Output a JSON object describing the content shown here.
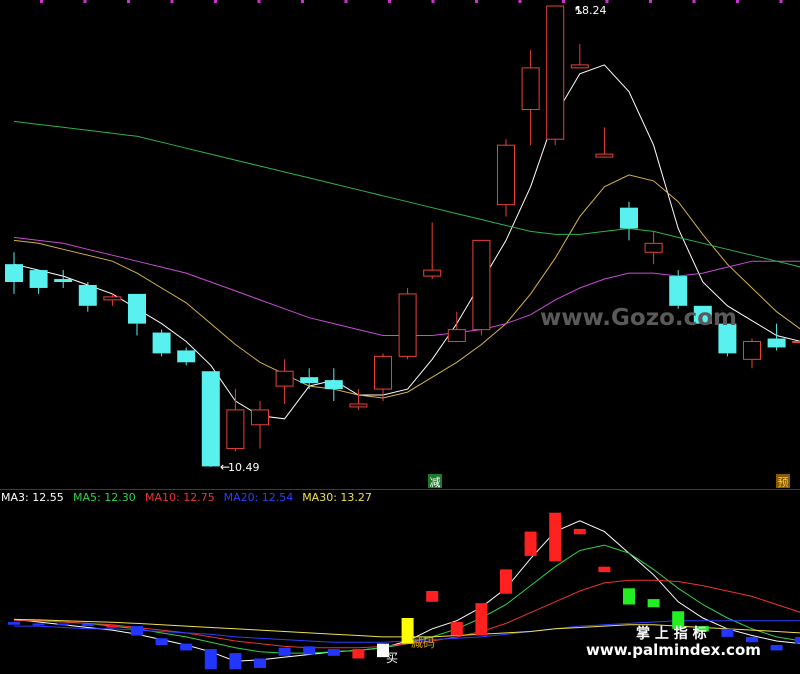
{
  "colors": {
    "bg": "#000000",
    "up": "#e8413a",
    "down": "#59f0f0",
    "ma_white": "#ffffff",
    "ma_green": "#2fb34a",
    "ma_magenta": "#c84bd6",
    "ma_yellow": "#d6b24a",
    "dots": "#cc33cc",
    "divider": "#8b1a1a"
  },
  "labels": {
    "high": "18.24",
    "low": "10.49",
    "sig_jian": "减",
    "sig_yu": "预",
    "bottom_jian": "减码",
    "bottom_mai": "买",
    "watermark1": "www.Gozo.com",
    "watermark2_title": "掌 上 指 标",
    "watermark2_url": "www.palmindex.com"
  },
  "legend": [
    {
      "label": "MA3:",
      "value": "12.55",
      "color": "#ffffff"
    },
    {
      "label": "MA5:",
      "value": "12.30",
      "color": "#2fd14a"
    },
    {
      "label": "MA10:",
      "value": "12.75",
      "color": "#e83434"
    },
    {
      "label": "MA20:",
      "value": "12.54",
      "color": "#2d3dff"
    },
    {
      "label": "MA30:",
      "value": "13.27",
      "color": "#f0e050"
    }
  ],
  "chart_data": {
    "type": "candlestick",
    "upper_candles": [
      {
        "open": 13.6,
        "close": 13.9,
        "high": 14.1,
        "low": 13.4,
        "dir": "down"
      },
      {
        "open": 13.5,
        "close": 13.8,
        "high": 13.8,
        "low": 13.4,
        "dir": "down"
      },
      {
        "open": 13.6,
        "close": 13.65,
        "high": 13.8,
        "low": 13.5,
        "dir": "down"
      },
      {
        "open": 13.2,
        "close": 13.55,
        "high": 13.6,
        "low": 13.1,
        "dir": "down"
      },
      {
        "open": 13.3,
        "close": 13.35,
        "high": 13.4,
        "low": 13.2,
        "dir": "up"
      },
      {
        "open": 12.9,
        "close": 13.4,
        "high": 13.4,
        "low": 12.7,
        "dir": "down"
      },
      {
        "open": 12.4,
        "close": 12.75,
        "high": 12.8,
        "low": 12.35,
        "dir": "down"
      },
      {
        "open": 12.25,
        "close": 12.45,
        "high": 12.5,
        "low": 12.2,
        "dir": "down"
      },
      {
        "open": 10.5,
        "close": 12.1,
        "high": 12.1,
        "low": 10.49,
        "dir": "down"
      },
      {
        "open": 10.8,
        "close": 11.45,
        "high": 11.8,
        "low": 10.75,
        "dir": "up"
      },
      {
        "open": 11.2,
        "close": 11.45,
        "high": 11.6,
        "low": 10.8,
        "dir": "up"
      },
      {
        "open": 11.85,
        "close": 12.1,
        "high": 12.3,
        "low": 11.55,
        "dir": "up"
      },
      {
        "open": 11.9,
        "close": 12.0,
        "high": 12.15,
        "low": 11.8,
        "dir": "down"
      },
      {
        "open": 11.8,
        "close": 11.95,
        "high": 12.15,
        "low": 11.6,
        "dir": "down"
      },
      {
        "open": 11.5,
        "close": 11.55,
        "high": 11.8,
        "low": 11.45,
        "dir": "up"
      },
      {
        "open": 11.8,
        "close": 12.35,
        "high": 12.4,
        "low": 11.6,
        "dir": "up"
      },
      {
        "open": 12.35,
        "close": 13.4,
        "high": 13.5,
        "low": 12.3,
        "dir": "up"
      },
      {
        "open": 13.7,
        "close": 13.8,
        "high": 14.6,
        "low": 13.65,
        "dir": "up"
      },
      {
        "open": 12.6,
        "close": 12.8,
        "high": 13.1,
        "low": 12.6,
        "dir": "up"
      },
      {
        "open": 12.8,
        "close": 14.3,
        "high": 14.3,
        "low": 12.7,
        "dir": "up"
      },
      {
        "open": 14.9,
        "close": 15.9,
        "high": 16.0,
        "low": 14.7,
        "dir": "up"
      },
      {
        "open": 16.5,
        "close": 17.2,
        "high": 17.5,
        "low": 15.9,
        "dir": "up"
      },
      {
        "open": 16.0,
        "close": 18.24,
        "high": 18.24,
        "low": 15.9,
        "dir": "up"
      },
      {
        "open": 17.2,
        "close": 17.25,
        "high": 17.6,
        "low": 17.2,
        "dir": "up"
      },
      {
        "open": 15.7,
        "close": 15.75,
        "high": 16.2,
        "low": 15.7,
        "dir": "up"
      },
      {
        "open": 14.5,
        "close": 14.85,
        "high": 14.95,
        "low": 14.3,
        "dir": "down"
      },
      {
        "open": 14.1,
        "close": 14.25,
        "high": 14.45,
        "low": 13.9,
        "dir": "up"
      },
      {
        "open": 13.2,
        "close": 13.7,
        "high": 13.8,
        "low": 13.15,
        "dir": "down"
      },
      {
        "open": 12.9,
        "close": 13.2,
        "high": 13.2,
        "low": 12.9,
        "dir": "down"
      },
      {
        "open": 12.4,
        "close": 12.9,
        "high": 12.9,
        "low": 12.35,
        "dir": "down"
      },
      {
        "open": 12.3,
        "close": 12.6,
        "high": 12.65,
        "low": 12.15,
        "dir": "up"
      },
      {
        "open": 12.5,
        "close": 12.65,
        "high": 12.9,
        "low": 12.45,
        "dir": "down"
      },
      {
        "open": 12.6,
        "close": 12.6,
        "high": 12.9,
        "low": 12.55,
        "dir": "up"
      }
    ],
    "ma_upper": {
      "white": [
        13.9,
        13.8,
        13.7,
        13.55,
        13.4,
        13.15,
        12.9,
        12.6,
        12.2,
        11.6,
        11.35,
        11.3,
        11.85,
        11.95,
        11.7,
        11.7,
        11.8,
        12.3,
        12.9,
        13.6,
        14.3,
        15.2,
        16.4,
        17.1,
        17.25,
        16.8,
        15.9,
        14.5,
        13.6,
        13.2,
        12.95,
        12.7,
        12.6
      ],
      "yellow": [
        14.3,
        14.25,
        14.15,
        14.05,
        13.95,
        13.75,
        13.5,
        13.25,
        12.9,
        12.55,
        12.25,
        12.05,
        11.85,
        11.8,
        11.7,
        11.65,
        11.75,
        12.0,
        12.25,
        12.55,
        12.9,
        13.4,
        14.0,
        14.7,
        15.2,
        15.4,
        15.3,
        14.95,
        14.4,
        13.9,
        13.5,
        13.1,
        12.8
      ],
      "magenta": [
        14.35,
        14.3,
        14.25,
        14.15,
        14.05,
        13.95,
        13.85,
        13.75,
        13.6,
        13.45,
        13.3,
        13.15,
        13.0,
        12.9,
        12.8,
        12.7,
        12.7,
        12.7,
        12.75,
        12.8,
        12.9,
        13.05,
        13.3,
        13.5,
        13.65,
        13.75,
        13.75,
        13.7,
        13.75,
        13.85,
        13.95,
        13.95,
        13.95
      ],
      "green": [
        16.3,
        16.25,
        16.2,
        16.15,
        16.1,
        16.05,
        15.95,
        15.85,
        15.75,
        15.65,
        15.55,
        15.45,
        15.35,
        15.25,
        15.15,
        15.05,
        14.95,
        14.85,
        14.75,
        14.65,
        14.55,
        14.45,
        14.4,
        14.4,
        14.45,
        14.5,
        14.45,
        14.35,
        14.25,
        14.15,
        14.05,
        13.95,
        13.85
      ]
    },
    "lower_indicator": {
      "blocks": [
        {
          "top": 0.25,
          "bottom": 0.15,
          "color": "#2236ff"
        },
        {
          "top": 0.2,
          "bottom": 0.13,
          "color": "#2236ff"
        },
        {
          "top": 0.2,
          "bottom": 0.13,
          "color": "#2236ff"
        },
        {
          "top": 0.18,
          "bottom": 0.1,
          "color": "#2236ff"
        },
        {
          "top": 0.12,
          "bottom": 0.07,
          "color": "#ff2020"
        },
        {
          "top": 0.1,
          "bottom": -0.25,
          "color": "#2236ff"
        },
        {
          "top": -0.35,
          "bottom": -0.6,
          "color": "#2236ff"
        },
        {
          "top": -0.55,
          "bottom": -0.8,
          "color": "#2236ff"
        },
        {
          "top": -0.75,
          "bottom": -1.5,
          "color": "#2236ff"
        },
        {
          "top": -0.9,
          "bottom": -1.5,
          "color": "#2236ff"
        },
        {
          "top": -1.1,
          "bottom": -1.45,
          "color": "#2236ff"
        },
        {
          "top": -0.7,
          "bottom": -1.0,
          "color": "#2236ff"
        },
        {
          "top": -0.65,
          "bottom": -0.95,
          "color": "#2236ff"
        },
        {
          "top": -0.75,
          "bottom": -1.0,
          "color": "#2236ff"
        },
        {
          "top": -0.75,
          "bottom": -1.1,
          "color": "#ff2020"
        },
        {
          "top": -0.55,
          "bottom": -1.05,
          "color": "#ffffff"
        },
        {
          "top": 0.4,
          "bottom": -0.55,
          "color": "#ffff00"
        },
        {
          "top": 1.4,
          "bottom": 1.0,
          "color": "#ff2020"
        },
        {
          "top": 0.25,
          "bottom": -0.25,
          "color": "#ff2020"
        },
        {
          "top": 0.95,
          "bottom": -0.25,
          "color": "#ff2020"
        },
        {
          "top": 2.2,
          "bottom": 1.3,
          "color": "#ff2020"
        },
        {
          "top": 3.6,
          "bottom": 2.7,
          "color": "#ff2020"
        },
        {
          "top": 4.3,
          "bottom": 2.5,
          "color": "#ff2020"
        },
        {
          "top": 3.7,
          "bottom": 3.5,
          "color": "#ff2020"
        },
        {
          "top": 2.3,
          "bottom": 2.1,
          "color": "#ff2020"
        },
        {
          "top": 1.5,
          "bottom": 0.9,
          "color": "#22ee22"
        },
        {
          "top": 1.1,
          "bottom": 0.8,
          "color": "#22ee22"
        },
        {
          "top": 0.65,
          "bottom": 0.0,
          "color": "#22ee22"
        },
        {
          "top": 0.1,
          "bottom": -0.1,
          "color": "#22ee22"
        },
        {
          "top": 0.0,
          "bottom": -0.3,
          "color": "#2236ff"
        },
        {
          "top": -0.3,
          "bottom": -0.5,
          "color": "#2236ff"
        },
        {
          "top": -0.6,
          "bottom": -0.8,
          "color": "#2236ff"
        },
        {
          "top": -0.3,
          "bottom": -0.55,
          "color": "#2236ff"
        }
      ],
      "lines": {
        "white": [
          0.35,
          0.25,
          0.15,
          0.05,
          -0.05,
          -0.2,
          -0.4,
          -0.6,
          -0.85,
          -1.2,
          -1.15,
          -1.05,
          -0.95,
          -0.85,
          -0.8,
          -0.7,
          -0.45,
          0.0,
          0.3,
          0.8,
          1.5,
          2.6,
          3.6,
          4.0,
          3.6,
          2.8,
          2.0,
          1.0,
          0.4,
          0.0,
          -0.25,
          -0.45,
          -0.55
        ],
        "green": [
          0.35,
          0.3,
          0.25,
          0.2,
          0.1,
          0.0,
          -0.15,
          -0.3,
          -0.5,
          -0.7,
          -0.85,
          -0.9,
          -0.9,
          -0.85,
          -0.8,
          -0.7,
          -0.55,
          -0.3,
          0.0,
          0.4,
          0.9,
          1.6,
          2.3,
          2.9,
          3.1,
          2.8,
          2.2,
          1.5,
          0.9,
          0.4,
          0.0,
          -0.3,
          -0.45
        ],
        "red": [
          0.3,
          0.3,
          0.25,
          0.2,
          0.15,
          0.05,
          -0.05,
          -0.15,
          -0.3,
          -0.45,
          -0.55,
          -0.65,
          -0.7,
          -0.7,
          -0.7,
          -0.65,
          -0.55,
          -0.45,
          -0.3,
          -0.1,
          0.2,
          0.6,
          1.0,
          1.4,
          1.7,
          1.8,
          1.8,
          1.75,
          1.6,
          1.4,
          1.2,
          0.9,
          0.6
        ],
        "blue": [
          0.1,
          0.1,
          0.05,
          0.0,
          0.0,
          -0.05,
          -0.1,
          -0.15,
          -0.2,
          -0.3,
          -0.35,
          -0.4,
          -0.45,
          -0.5,
          -0.5,
          -0.5,
          -0.45,
          -0.4,
          -0.35,
          -0.3,
          -0.2,
          -0.1,
          0.0,
          0.1,
          0.15,
          0.2,
          0.25,
          0.3,
          0.3,
          0.3,
          0.3,
          0.3,
          0.3
        ],
        "yellow": [
          0.35,
          0.33,
          0.3,
          0.27,
          0.24,
          0.2,
          0.15,
          0.1,
          0.05,
          0.0,
          -0.05,
          -0.1,
          -0.15,
          -0.2,
          -0.25,
          -0.3,
          -0.3,
          -0.3,
          -0.25,
          -0.2,
          -0.15,
          -0.1,
          0.0,
          0.05,
          0.1,
          0.15,
          0.15,
          0.1,
          0.05,
          0.0,
          -0.05,
          -0.1,
          -0.15
        ]
      }
    }
  }
}
